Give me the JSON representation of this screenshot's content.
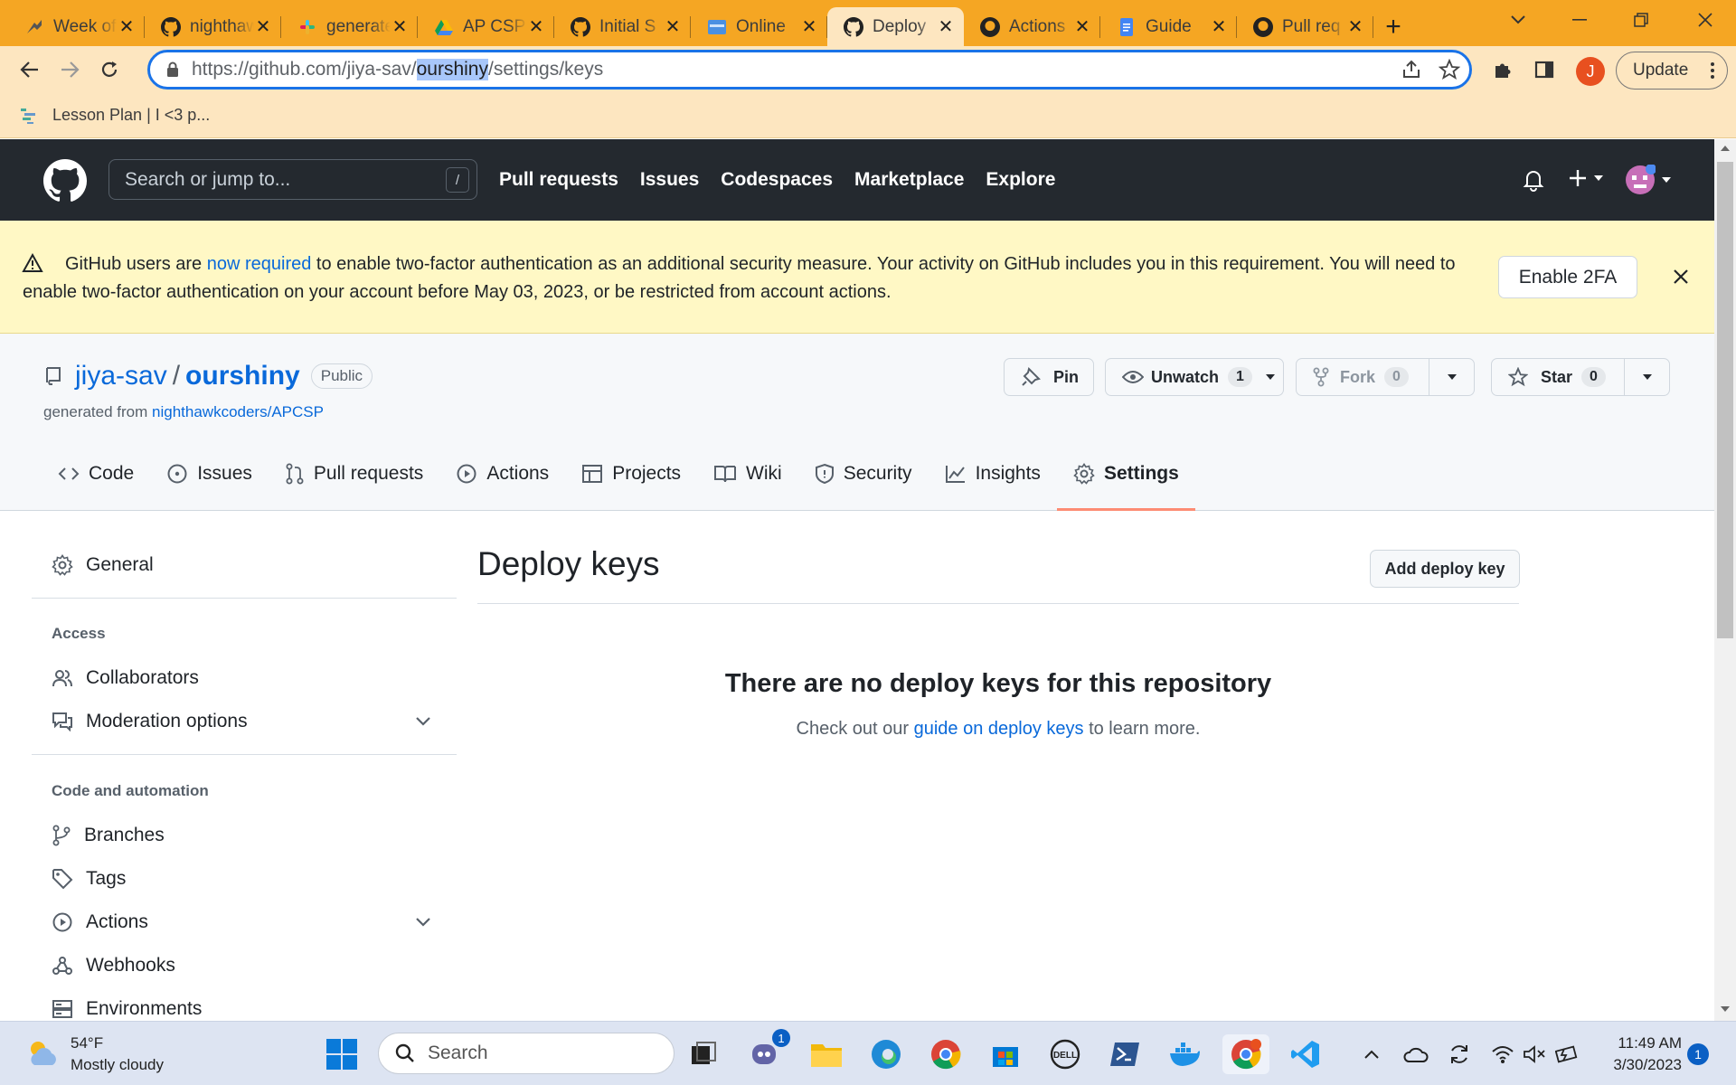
{
  "browser": {
    "tabs": [
      {
        "title": "Week of",
        "icon": "tool-icon"
      },
      {
        "title": "nighthawk",
        "icon": "github-icon"
      },
      {
        "title": "generate",
        "icon": "slack-icon"
      },
      {
        "title": "AP CSP",
        "icon": "drive-icon"
      },
      {
        "title": "Initial S",
        "icon": "github-icon"
      },
      {
        "title": "Online",
        "icon": "site-icon"
      },
      {
        "title": "Deploy",
        "icon": "github-icon",
        "active": true
      },
      {
        "title": "Actions",
        "icon": "github-icon"
      },
      {
        "title": "Guide",
        "icon": "docs-icon"
      },
      {
        "title": "Pull req",
        "icon": "github-icon"
      }
    ],
    "url_prefix": "https://github.com/jiya-sav/",
    "url_highlight": "ourshiny",
    "url_suffix": "/settings/keys",
    "profile_initial": "J",
    "update_label": "Update",
    "bookmark": "Lesson Plan | I <3 p..."
  },
  "github": {
    "search_placeholder": "Search or jump to...",
    "search_shortcut": "/",
    "nav": [
      "Pull requests",
      "Issues",
      "Codespaces",
      "Marketplace",
      "Explore"
    ],
    "banner": {
      "text_before": "GitHub users are ",
      "link": "now required",
      "text_after": " to enable two-factor authentication as an additional security measure. Your activity on GitHub includes you in this requirement. You will need to enable two-factor authentication on your account before May 03, 2023, or be restricted from account actions.",
      "button": "Enable 2FA"
    },
    "repo": {
      "owner": "jiya-sav",
      "name": "ourshiny",
      "visibility": "Public",
      "generated_prefix": "generated from ",
      "generated_link": "nighthawkcoders/APCSP",
      "pin": "Pin",
      "unwatch": "Unwatch",
      "watch_count": "1",
      "fork": "Fork",
      "fork_count": "0",
      "star": "Star",
      "star_count": "0"
    },
    "tabs": [
      "Code",
      "Issues",
      "Pull requests",
      "Actions",
      "Projects",
      "Wiki",
      "Security",
      "Insights",
      "Settings"
    ],
    "sidebar": {
      "general": "General",
      "access_heading": "Access",
      "collaborators": "Collaborators",
      "moderation": "Moderation options",
      "code_heading": "Code and automation",
      "branches": "Branches",
      "tags": "Tags",
      "actions": "Actions",
      "webhooks": "Webhooks",
      "environments": "Environments"
    },
    "main": {
      "title": "Deploy keys",
      "add_button": "Add deploy key",
      "blank_title": "There are no deploy keys for this repository",
      "blank_before": "Check out our ",
      "blank_link": "guide on deploy keys",
      "blank_after": " to learn more."
    }
  },
  "taskbar": {
    "temp": "54°F",
    "weather": "Mostly cloudy",
    "search": "Search",
    "time": "11:49 AM",
    "date": "3/30/2023",
    "notifications": "1",
    "teams_badge": "1"
  }
}
